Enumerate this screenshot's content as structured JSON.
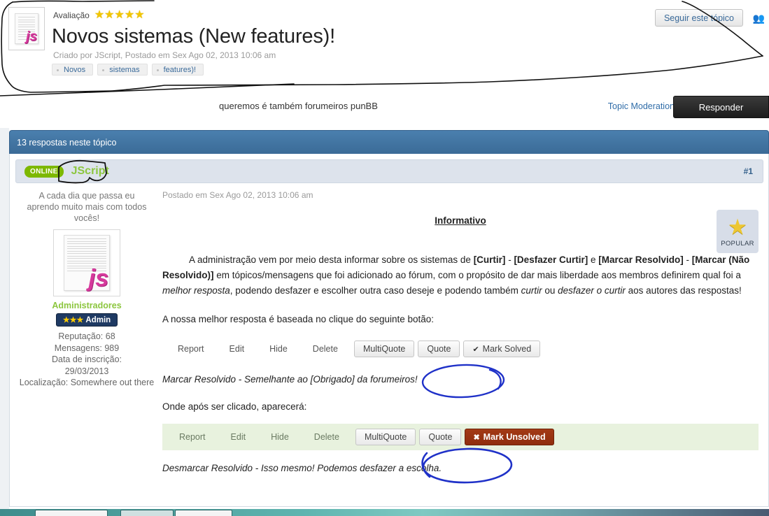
{
  "header": {
    "rating_label": "Avaliação",
    "stars": "★★★★★",
    "title": "Novos sistemas (New features)!",
    "subtitle": "Criado por JScript, Postado em Sex Ago 02, 2013 10:06 am",
    "tags": [
      "Novos",
      "sistemas",
      "features)!"
    ],
    "follow_button": "Seguir este tópico",
    "follow_icon": "members-icon"
  },
  "subbar": {
    "note": "queremos é também forumeiros punBB",
    "topic_moderation": "Topic Moderation",
    "reply_button": "Responder"
  },
  "replies_bar": {
    "label": "13 respostas neste tópico"
  },
  "post": {
    "online_badge": "ONLINE",
    "username": "JScript",
    "post_number": "#1",
    "date": "Postado em Sex Ago 02, 2013 10:06 am",
    "popular_badge": "POPULAR",
    "sidebar": {
      "quote": "A cada dia que passa eu aprendo muito mais com todos vocês!",
      "rank": "Administradores",
      "badge_stars": "★★★",
      "badge_label": "Admin",
      "reputation": "Reputação: 68",
      "messages": "Mensagens: 989",
      "joined_label": "Data de inscrição:",
      "joined_date": "29/03/2013",
      "location": "Localização: Somewhere out there"
    },
    "content": {
      "heading": "Informativo",
      "paragraph_parts": [
        {
          "t": "A administração vem por meio desta informar sobre os sistemas de ",
          "s": "normal"
        },
        {
          "t": "[Curtir]",
          "s": "bold"
        },
        {
          "t": " - ",
          "s": "normal"
        },
        {
          "t": "[Desfazer Curtir]",
          "s": "bold"
        },
        {
          "t": " e ",
          "s": "normal"
        },
        {
          "t": "[Marcar Resolvido]",
          "s": "bold"
        },
        {
          "t": " - ",
          "s": "normal"
        },
        {
          "t": "[Marcar (Não Resolvido)]",
          "s": "bold"
        },
        {
          "t": " em tópicos/mensagens que foi adicionado ao fórum, com o propósito de dar mais liberdade aos membros definirem qual foi a ",
          "s": "normal"
        },
        {
          "t": "melhor resposta",
          "s": "italic"
        },
        {
          "t": ", podendo desfazer e escolher outra caso deseje e podendo também ",
          "s": "normal"
        },
        {
          "t": "curtir",
          "s": "italic"
        },
        {
          "t": " ou ",
          "s": "normal"
        },
        {
          "t": "desfazer o curtir",
          "s": "italic"
        },
        {
          "t": " aos autores das respostas!",
          "s": "normal"
        }
      ],
      "line_best_answer": "A nossa melhor resposta é baseada no clique do seguinte botão:",
      "note_solved": "Marcar Resolvido - Semelhante ao [Obrigado] da forumeiros!",
      "line_after_click": "Onde após ser clicado, aparecerá:",
      "note_unsolved": "Desmarcar Resolvido - Isso mesmo! Podemos desfazer a escolha."
    },
    "toolbar_solved": {
      "report": "Report",
      "edit": "Edit",
      "hide": "Hide",
      "delete": "Delete",
      "multiquote": "MultiQuote",
      "quote": "Quote",
      "mark_solved": "Mark Solved",
      "mark_solved_icon": "check-icon"
    },
    "toolbar_unsolved": {
      "report": "Report",
      "edit": "Edit",
      "hide": "Hide",
      "delete": "Delete",
      "multiquote": "MultiQuote",
      "quote": "Quote",
      "mark_unsolved": "Mark Unsolved",
      "mark_unsolved_icon": "undo-circle-icon"
    }
  },
  "colors": {
    "accent_blue": "#3b6b97",
    "link_blue": "#2f6ca8",
    "username_green": "#8cc63e",
    "online_green": "#7db800",
    "unsolved_red": "#8f2d0d",
    "shaded_row_green": "#e8f2de",
    "annotation_black": "#111111",
    "annotation_blue": "#1f31c8"
  }
}
